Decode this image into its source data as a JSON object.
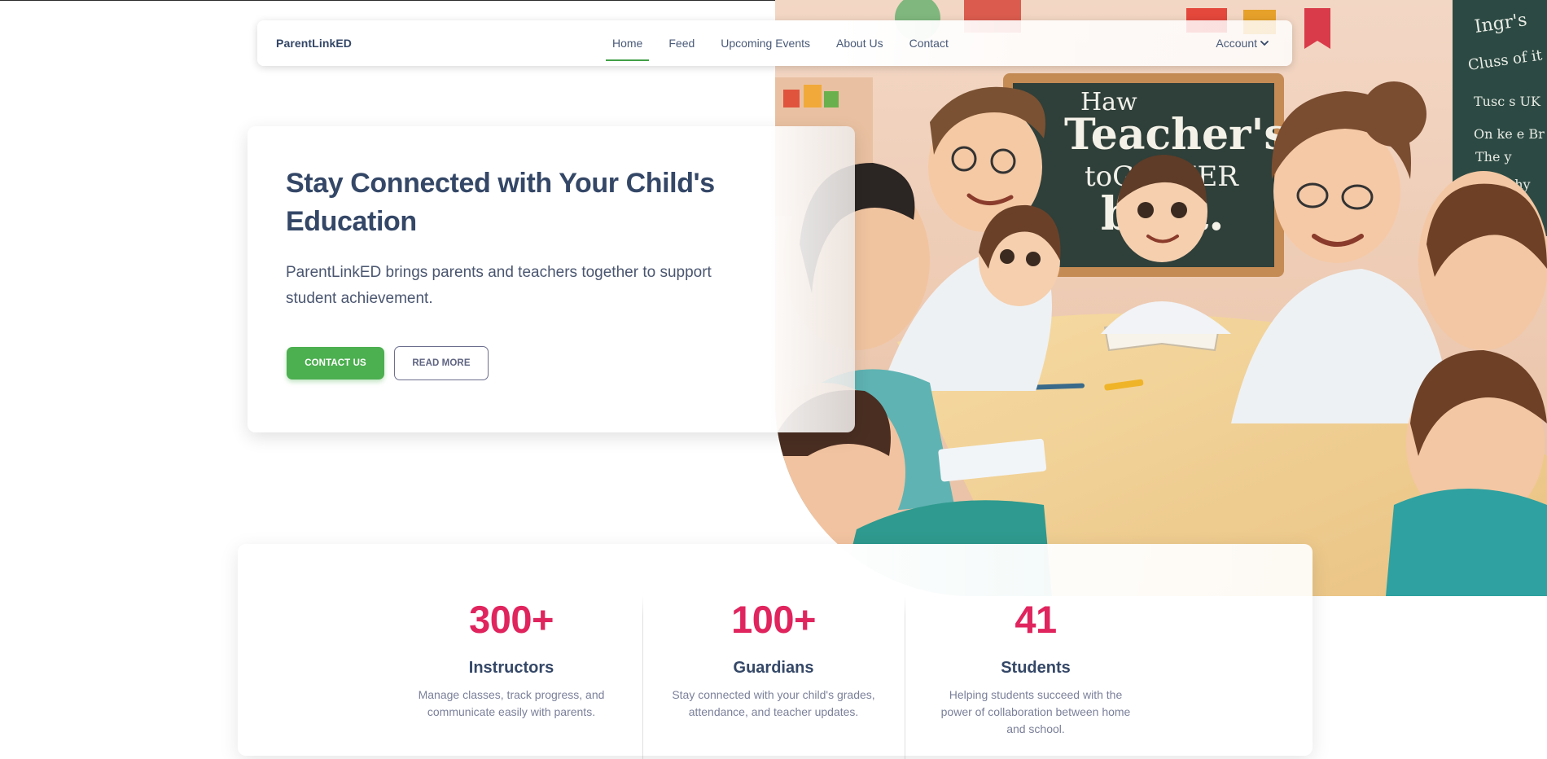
{
  "navbar": {
    "brand": "ParentLinkED",
    "links": [
      "Home",
      "Feed",
      "Upcoming Events",
      "About Us",
      "Contact"
    ],
    "active_link": "Home",
    "account_label": "Account"
  },
  "hero": {
    "title": "Stay Connected with Your Child's Education",
    "subtitle": "ParentLinkED brings parents and teachers together to support student achievement.",
    "primary_button": "CONTACT US",
    "secondary_button": "READ MORE",
    "illustration": {
      "board_text": [
        "Haw",
        "Teacher's",
        "toGETHER",
        "best."
      ],
      "side_board_text": [
        "Ingr's",
        "Cluss of it",
        "Tusc s UK",
        "On ke e Br",
        "The y",
        "Fish thy"
      ]
    }
  },
  "stats": [
    {
      "value": "300+",
      "label": "Instructors",
      "description": "Manage classes, track progress, and communicate easily with parents."
    },
    {
      "value": "100+",
      "label": "Guardians",
      "description": "Stay connected with your child's grades, attendance, and teacher updates."
    },
    {
      "value": "41",
      "label": "Students",
      "description": "Helping students succeed with the power of collaboration between home and school."
    }
  ],
  "colors": {
    "brand_text": "#344767",
    "accent_green": "#4caf50",
    "stat_pink": "#e0245e",
    "muted_text": "#7b809a"
  },
  "icons": {
    "account_dropdown": "chevron-down-icon"
  }
}
